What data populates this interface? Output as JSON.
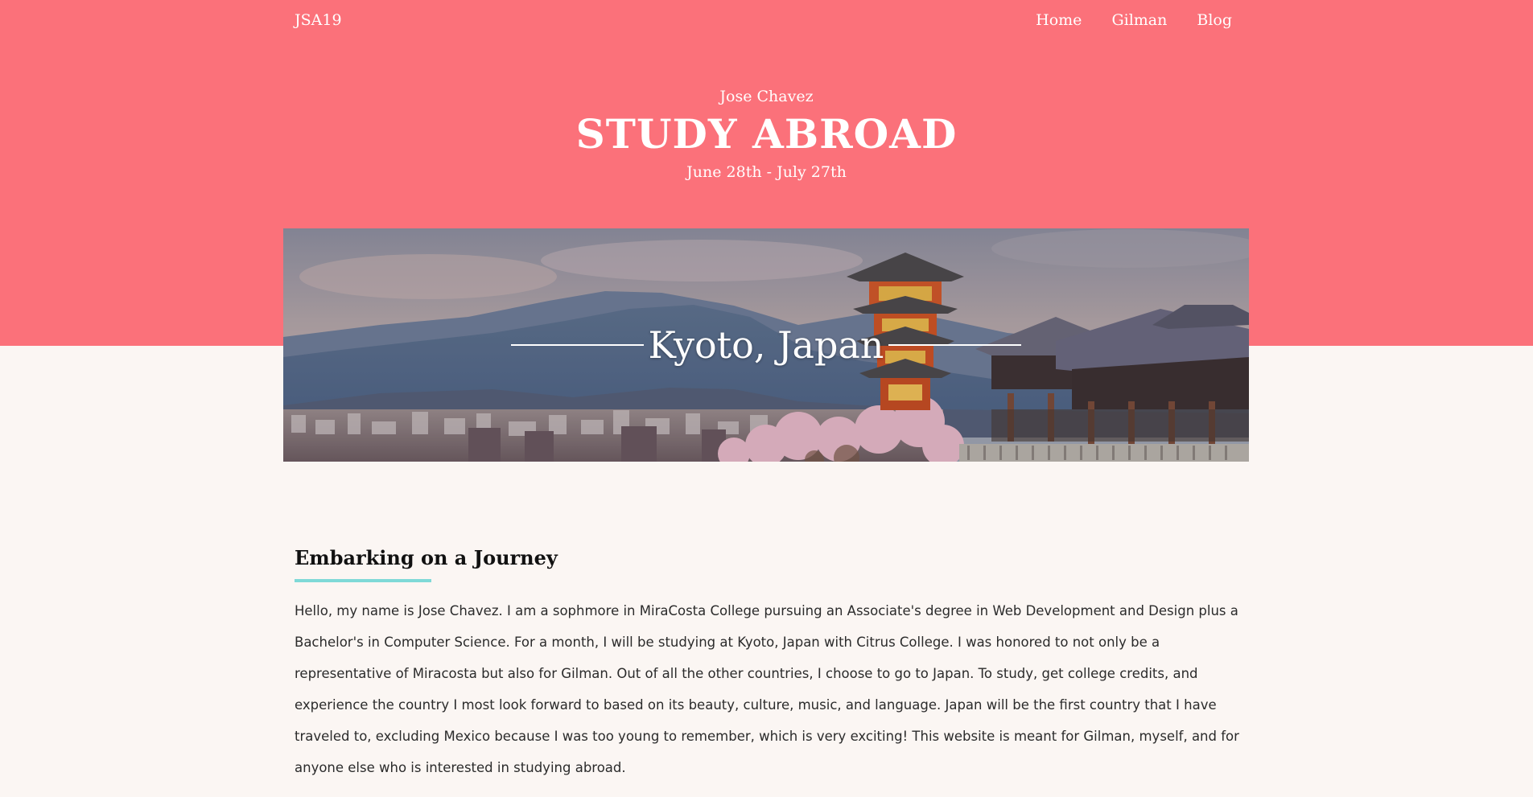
{
  "nav": {
    "brand": "JSA19",
    "links": [
      "Home",
      "Gilman",
      "Blog"
    ]
  },
  "header": {
    "author": "Jose Chavez",
    "title": "STUDY ABROAD",
    "dates": "June 28th - July 27th"
  },
  "banner": {
    "caption": "Kyoto, Japan"
  },
  "section": {
    "title": "Embarking on a Journey",
    "body": "Hello, my name is Jose Chavez. I am a sophmore in MiraCosta College pursuing an Associate's degree in Web Development and Design plus a Bachelor's in Computer Science. For a month, I will be studying at Kyoto, Japan with Citrus College. I was honored to not only be a representative of Miracosta but also for Gilman. Out of all the other countries, I choose to go to Japan. To study, get college credits, and experience the country I most look forward to based on its beauty, culture, music, and language. Japan will be the first country that I have traveled to, excluding Mexico because I was too young to remember, which is very exciting! This website is meant for Gilman, myself, and for anyone else who is interested in studying abroad."
  },
  "colors": {
    "hero": "#fb717a",
    "page_background": "#fbf6f3",
    "underline_accent": "#7fd9d7"
  }
}
